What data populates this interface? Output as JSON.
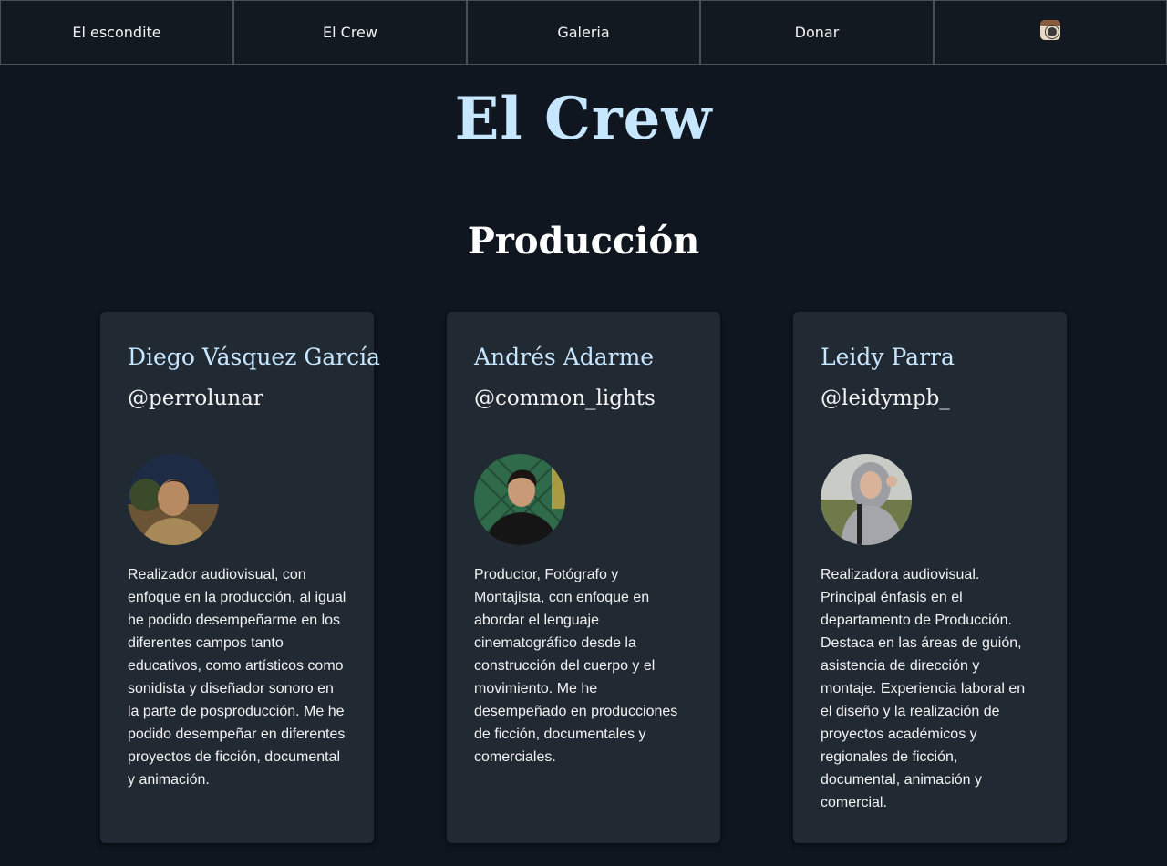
{
  "nav": {
    "items": [
      {
        "label": "El escondite"
      },
      {
        "label": "El Crew"
      },
      {
        "label": "Galeria"
      },
      {
        "label": "Donar"
      }
    ],
    "instagram_icon": "instagram-icon"
  },
  "page": {
    "title": "El Crew",
    "section_title": "Producción"
  },
  "colors": {
    "background": "#0f161f",
    "nav_background": "#121921",
    "card_background": "#212932",
    "accent_name": "#c7e6ff",
    "text": "#f2f2f2"
  },
  "crew": [
    {
      "name": "Diego Vásquez García",
      "handle": "@perrolunar",
      "bio": "Realizador audiovisual, con enfoque en la producción, al igual he podido desempeñarme en los diferentes campos tanto educativos, como artísticos como sonidista y diseñador sonoro en la parte de posproducción. Me he podido desempeñar en diferentes proyectos de ficción, documental y animación."
    },
    {
      "name": "Andrés Adarme",
      "handle": "@common_lights",
      "bio": "Productor, Fotógrafo y Montajista, con enfoque en abordar el lenguaje cinematográfico desde la construcción del cuerpo y el movimiento. Me he desempeñado en producciones de ficción, documentales y comerciales."
    },
    {
      "name": "Leidy Parra",
      "handle": "@leidympb_",
      "bio": "Realizadora audiovisual. Principal énfasis en el departamento de Producción. Destaca en las áreas de guión, asistencia de dirección y montaje. Experiencia laboral en el diseño y la realización de proyectos académicos y regionales de ficción, documental, animación y comercial."
    }
  ]
}
